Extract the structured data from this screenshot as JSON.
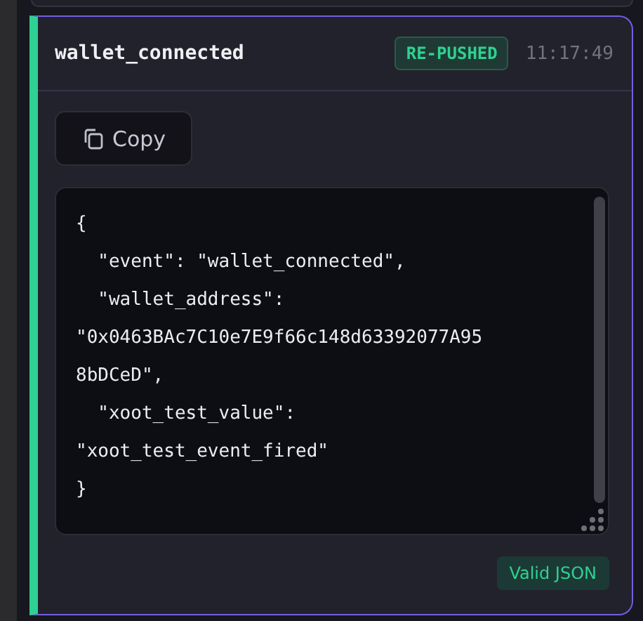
{
  "event_card": {
    "name": "wallet_connected",
    "badge": "RE-PUSHED",
    "time": "11:17:49",
    "copy_button": "Copy",
    "code_lines": [
      "{",
      "  \"event\": \"wallet_connected\",",
      "  \"wallet_address\":",
      "\"0x0463BAc7C10e7E9f66c148d63392077A95",
      "8bDCeD\",",
      "  \"xoot_test_value\":",
      "\"xoot_test_event_fired\"",
      "}"
    ],
    "validity": "Valid JSON"
  }
}
